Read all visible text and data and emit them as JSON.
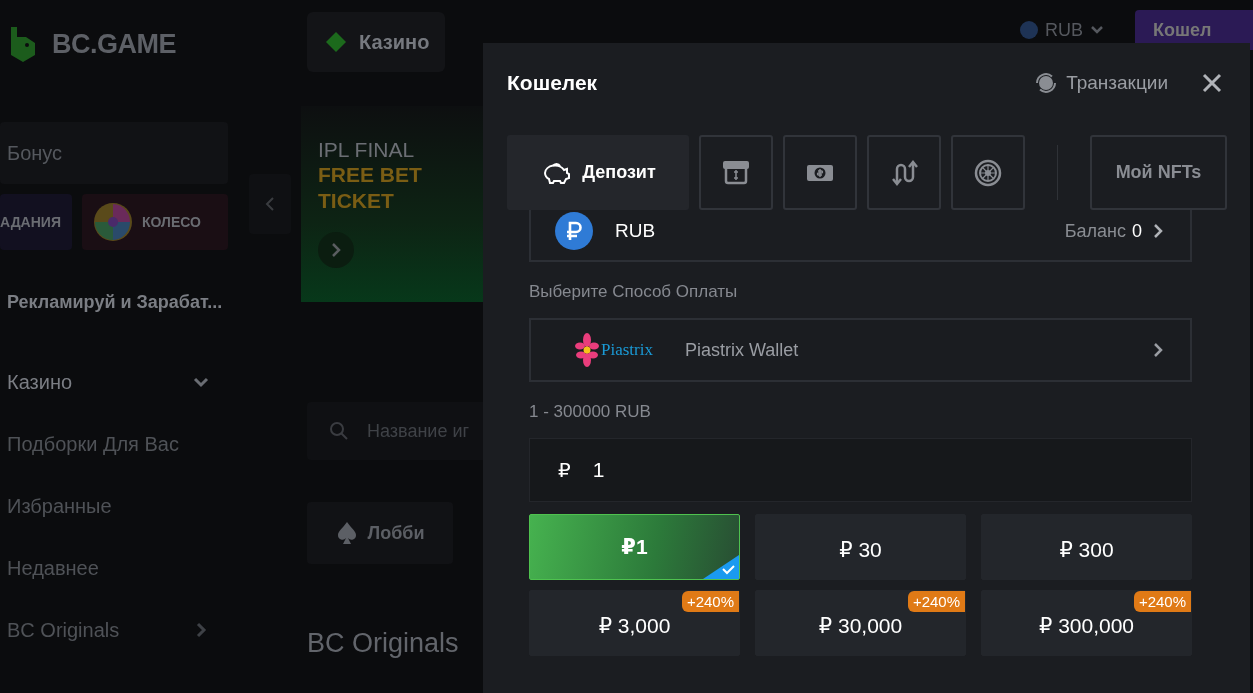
{
  "header": {
    "logo": "BC.GAME",
    "nav": [
      {
        "label": "Казино",
        "selected": true
      }
    ],
    "currency": "RUB",
    "wallet_button": "Кошел"
  },
  "sidebar": {
    "bonus": "Бонус",
    "tiles": [
      {
        "kind": "tasks",
        "label": "АДАНИЯ"
      },
      {
        "kind": "wheel",
        "label": "КОЛЕСО"
      }
    ],
    "promo": "Рекламируй и Зарабат...",
    "items": [
      {
        "label": "Казино",
        "kind": "group",
        "expanded": true
      },
      {
        "label": "Подборки Для Вас",
        "kind": "link"
      },
      {
        "label": "Избранные",
        "kind": "link"
      },
      {
        "label": "Недавнее",
        "kind": "link"
      },
      {
        "label": "BC Originals",
        "kind": "group",
        "expanded": false
      }
    ]
  },
  "banner": {
    "title": "IPL FINAL",
    "highlight_1": "FREE BET",
    "highlight_2": "TICKET"
  },
  "search": {
    "placeholder": "Название иг"
  },
  "lobby_tab": {
    "label": "Лобби"
  },
  "section_title": "BC Originals",
  "wallet": {
    "title": "Кошелек",
    "transactions": "Транзакции",
    "tabs": [
      {
        "kind": "deposit",
        "label": "Депозит",
        "selected": true
      },
      {
        "kind": "atm",
        "selected": false
      },
      {
        "kind": "cash",
        "selected": false
      },
      {
        "kind": "swap",
        "selected": false
      },
      {
        "kind": "vault",
        "selected": false
      },
      {
        "kind": "nft",
        "label": "Мой NFTs",
        "selected": false
      }
    ],
    "currency_row": {
      "code": "RUB",
      "balance_label": "Баланс",
      "balance": "0"
    },
    "method_label": "Выберите Способ Оплаты",
    "method": {
      "logo": "Piastrix",
      "name": "Piastrix Wallet"
    },
    "range": "1 - 300000 RUB",
    "amount": {
      "symbol": "₽",
      "value": "1"
    },
    "presets": [
      {
        "label": "₽1",
        "selected": true
      },
      {
        "label": "₽ 30",
        "selected": false
      },
      {
        "label": "₽ 300",
        "selected": false
      },
      {
        "label": "₽ 3,000",
        "selected": false,
        "badge": "+240%"
      },
      {
        "label": "₽ 30,000",
        "selected": false,
        "badge": "+240%"
      },
      {
        "label": "₽ 300,000",
        "selected": false,
        "badge": "+240%"
      }
    ]
  }
}
